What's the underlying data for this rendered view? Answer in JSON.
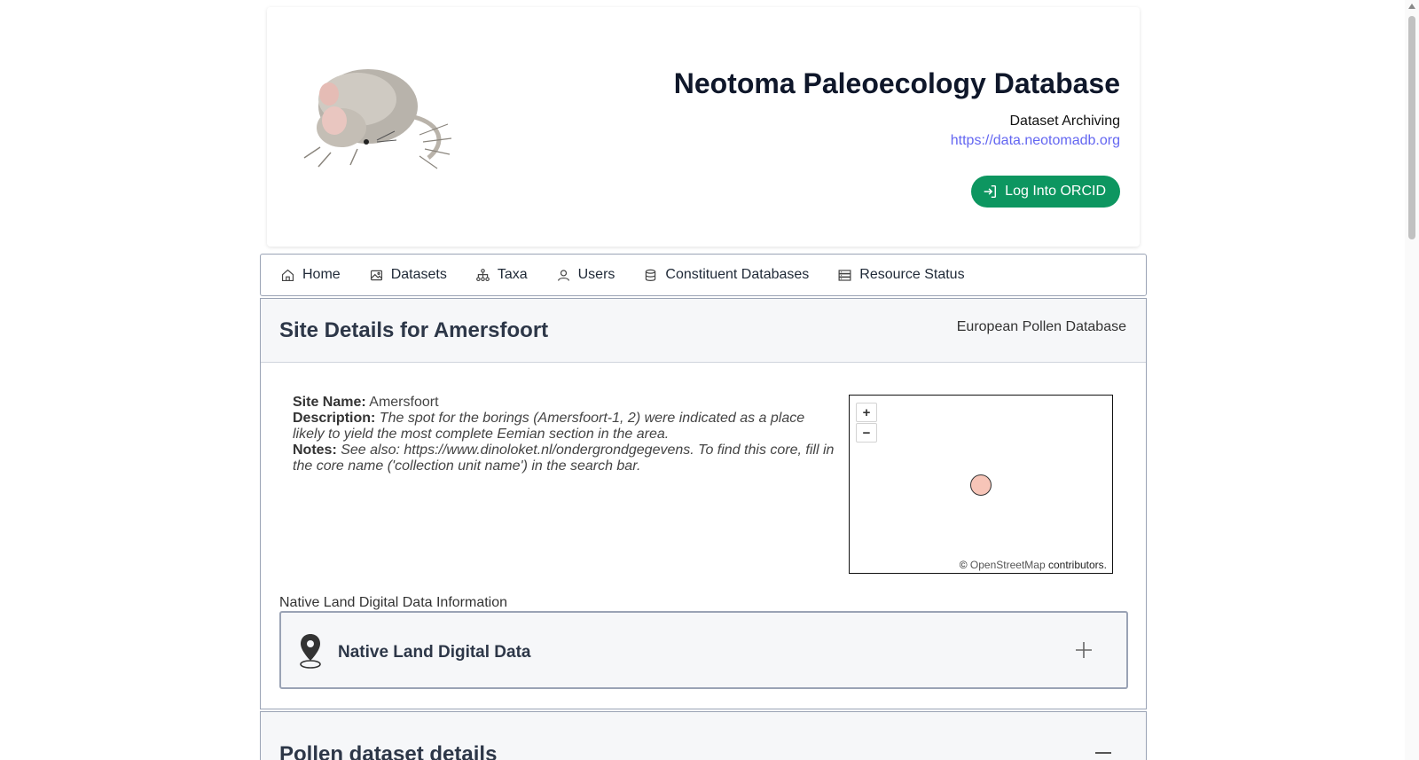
{
  "header": {
    "title": "Neotoma Paleoecology Database",
    "subtitle": "Dataset Archiving",
    "link": "https://data.neotomadb.org",
    "login_label": "Log Into ORCID"
  },
  "nav": {
    "items": [
      {
        "label": "Home",
        "icon": "home-icon"
      },
      {
        "label": "Datasets",
        "icon": "image-icon"
      },
      {
        "label": "Taxa",
        "icon": "hierarchy-icon"
      },
      {
        "label": "Users",
        "icon": "user-icon"
      },
      {
        "label": "Constituent Databases",
        "icon": "database-icon"
      },
      {
        "label": "Resource Status",
        "icon": "server-icon"
      }
    ]
  },
  "site": {
    "title": "Site Details for Amersfoort",
    "database": "European Pollen Database",
    "name_label": "Site Name:",
    "name": "Amersfoort",
    "description_label": "Description:",
    "description": "The spot for the borings (Amersfoort-1, 2) were indicated as a place likely to yield the most complete Eemian section in the area.",
    "notes_label": "Notes:",
    "notes": "See also: https://www.dinoloket.nl/ondergrondgegevens. To find this core, fill in the core name ('collection unit name') in the search bar."
  },
  "map": {
    "zoom_in": "+",
    "zoom_out": "−",
    "attribution_prefix": "©",
    "attribution_link": "OpenStreetMap",
    "attribution_suffix": "contributors.",
    "marker_color": "#f7c5b8"
  },
  "native_land": {
    "label": "Native Land Digital Data Information",
    "title": "Native Land Digital Data"
  },
  "pollen": {
    "title": "Pollen dataset details"
  },
  "colors": {
    "accent_green": "#0d9660",
    "link": "#6366f1"
  }
}
